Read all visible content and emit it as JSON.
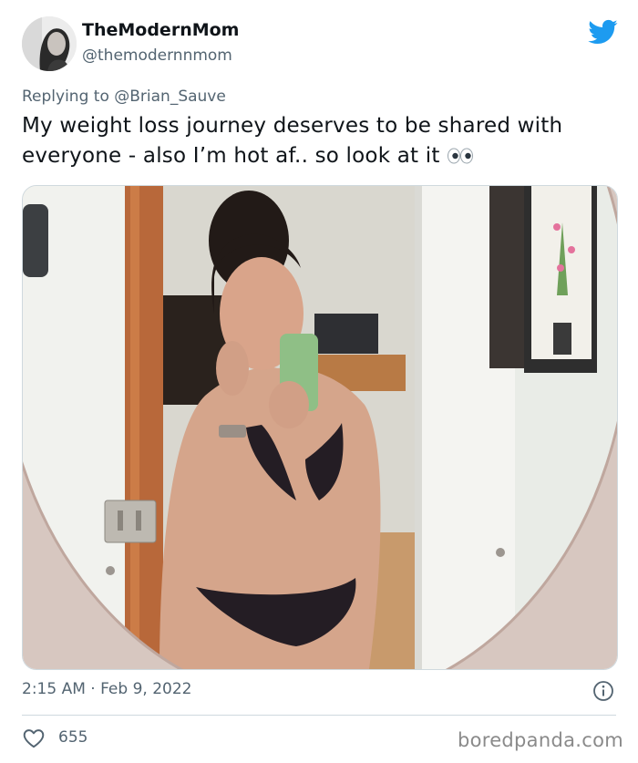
{
  "tweet": {
    "display_name": "TheModernMom",
    "handle": "@themodernnmom",
    "reply_prefix": "Replying to",
    "reply_to": "@Brian_Sauve",
    "text": "My weight loss journey deserves to be shared with everyone - also I’m hot af.. so look at it",
    "emoji": "eyes-emoji",
    "timestamp": "2:15 AM · Feb 9, 2022",
    "likes": "655"
  },
  "icons": {
    "brand": "twitter-bird-icon",
    "info": "info-icon",
    "like": "heart-icon"
  },
  "colors": {
    "twitter_blue": "#1d9bf0",
    "secondary_text": "#536471",
    "primary_text": "#0f1419"
  },
  "watermark": "boredpanda.com"
}
